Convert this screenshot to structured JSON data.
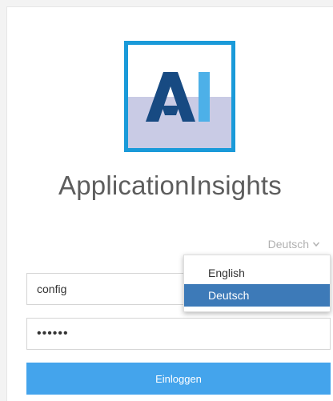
{
  "app": {
    "title": "ApplicationInsights",
    "logo_text": "AI"
  },
  "language": {
    "current": "Deutsch",
    "options": [
      "English",
      "Deutsch"
    ],
    "selected_index": 1
  },
  "form": {
    "username_value": "config",
    "password_mask": "••••••",
    "login_label": "Einloggen"
  },
  "colors": {
    "logo_border": "#1a9ad9",
    "logo_letters": "#174a82",
    "logo_accent": "#4db0e8",
    "button": "#44a4ec",
    "dropdown_selected": "#3d7ab8"
  }
}
